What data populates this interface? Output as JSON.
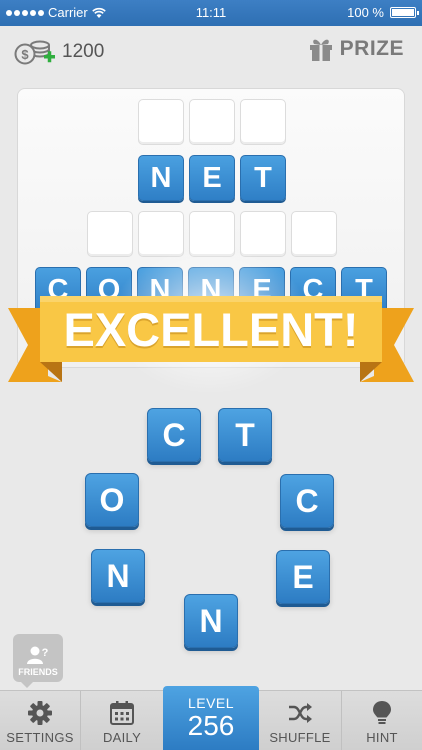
{
  "status_bar": {
    "carrier": "Carrier",
    "time": "11:11",
    "battery": "100 %"
  },
  "header": {
    "coins": "1200",
    "prize_label": "PRIZE",
    "coin_icon": "coin-stack-plus-icon",
    "prize_icon": "gift-icon"
  },
  "board": {
    "row1_letters": [
      "",
      "",
      ""
    ],
    "row2_letters": [
      "N",
      "E",
      "T"
    ],
    "row3_letters": [
      "",
      "",
      "",
      "",
      ""
    ],
    "row4_letters": [
      "C",
      "O",
      "N",
      "N",
      "E",
      "C",
      "T"
    ]
  },
  "banner": {
    "text": "EXCELLENT!"
  },
  "wheel": {
    "letters": [
      "C",
      "T",
      "O",
      "C",
      "N",
      "E",
      "N"
    ]
  },
  "friends": {
    "label": "FRIENDS"
  },
  "bottom_bar": {
    "settings_label": "SETTINGS",
    "daily_label": "DAILY",
    "level_label": "LEVEL",
    "level_number": "256",
    "shuffle_label": "SHUFFLE",
    "hint_label": "HINT"
  },
  "colors": {
    "tile_blue": "#2f7fc6",
    "banner_yellow": "#f9c745",
    "status_bar": "#3379bd"
  }
}
